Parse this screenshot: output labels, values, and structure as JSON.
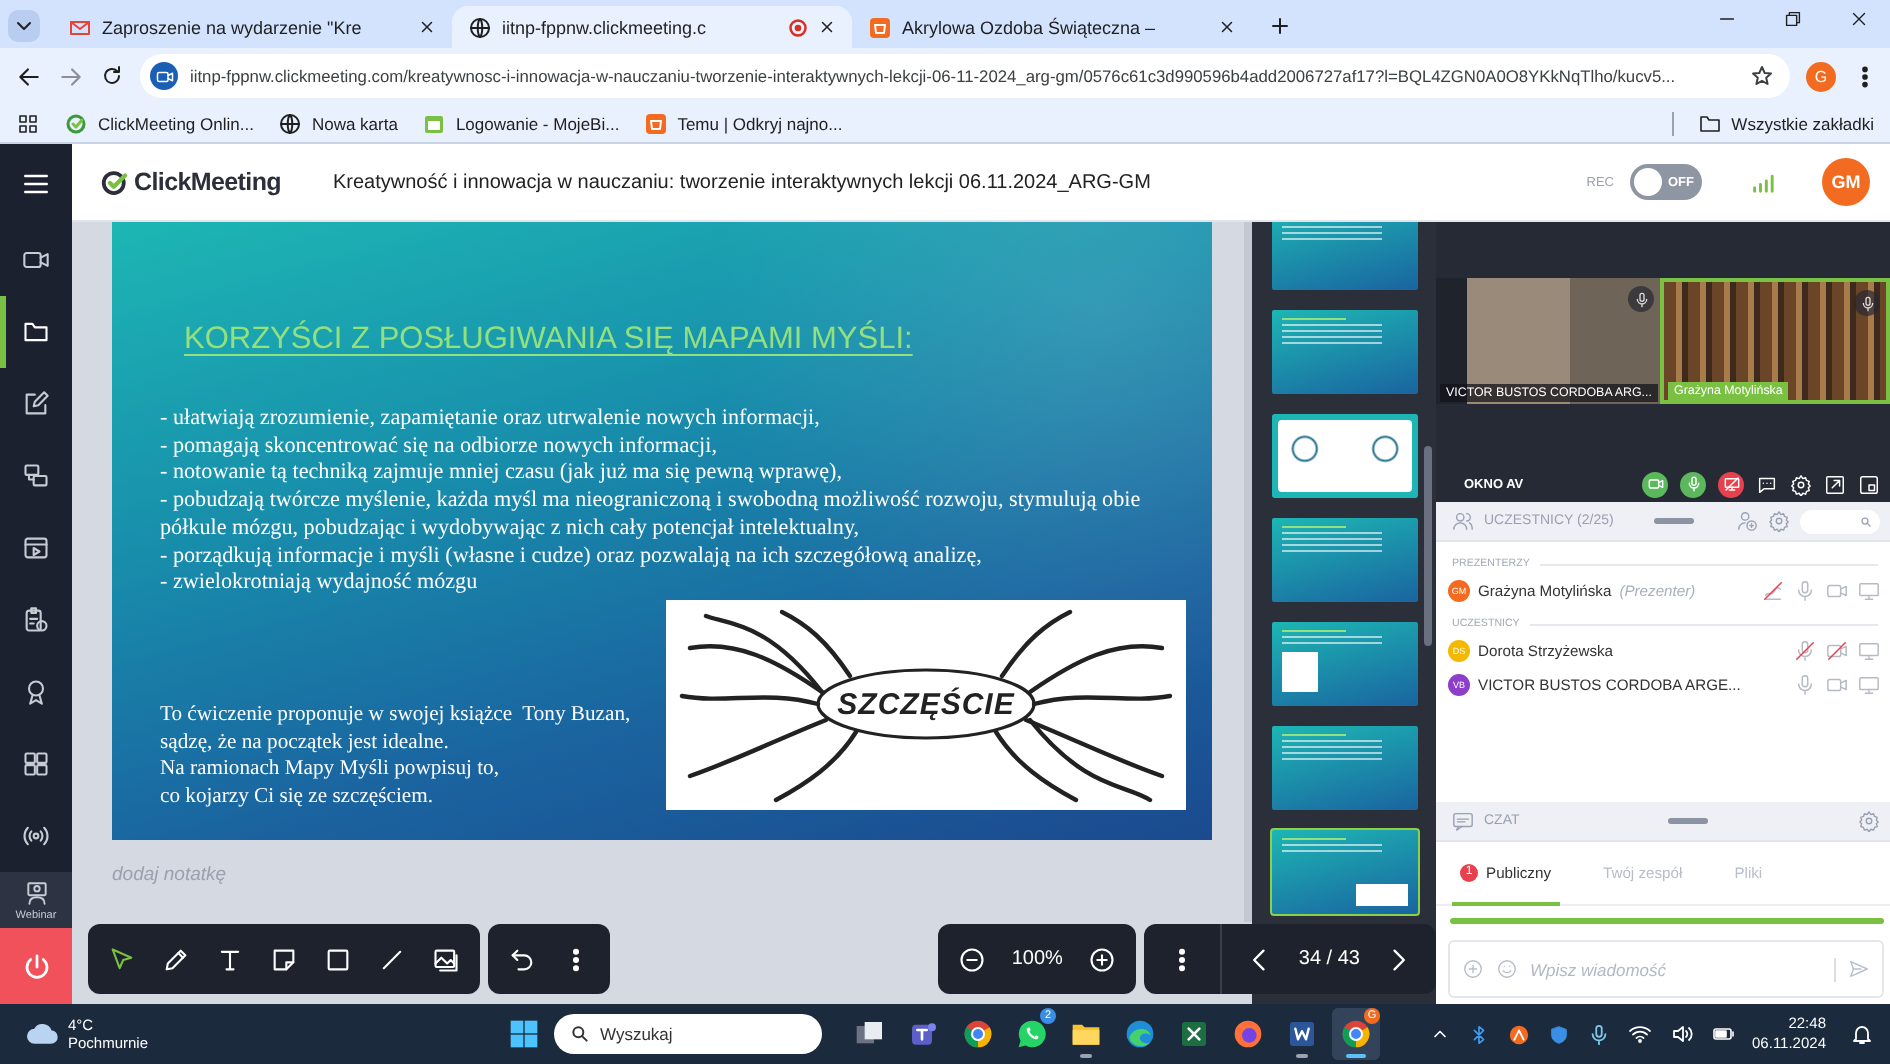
{
  "browser": {
    "tabs": [
      {
        "title": "Zaproszenie na wydarzenie \"Kre",
        "kind": "mail",
        "selected": false,
        "recording": false
      },
      {
        "title": "iitnp-fppnw.clickmeeting.c",
        "kind": "globe",
        "selected": true,
        "recording": true
      },
      {
        "title": "Akrylowa Ozdoba Świąteczna –",
        "kind": "shop",
        "selected": false,
        "recording": false
      }
    ],
    "url": "iitnp-fppnw.clickmeeting.com/kreatywnosc-i-innowacja-w-nauczaniu-tworzenie-interaktywnych-lekcji-06-11-2024_arg-gm/0576c61c3d990596b4add2006727af17?l=BQL4ZGN0A0O8YKkNqTlho/kucv5...",
    "profile": "G",
    "bookmarks": [
      {
        "label": "ClickMeeting Onlin...",
        "kind": "logo"
      },
      {
        "label": "Nowa karta",
        "kind": "globe"
      },
      {
        "label": "Logowanie - MojeBi...",
        "kind": "calendar"
      },
      {
        "label": "Temu | Odkryj najno...",
        "kind": "shop"
      }
    ],
    "all_bookmarks": "Wszystkie zakładki"
  },
  "header": {
    "logo": "ClickMeeting",
    "title": "Kreatywność i innowacja w nauczaniu: tworzenie interaktywnych lekcji 06.11.2024_ARG-GM",
    "rec_label": "REC",
    "rec_switch": {
      "label": "OFF",
      "on": false
    },
    "avatar": "GM"
  },
  "sidebar": {
    "items": [
      {
        "kind": "camera",
        "selected": false
      },
      {
        "kind": "folder",
        "selected": true
      },
      {
        "kind": "edit",
        "selected": false
      },
      {
        "kind": "screens",
        "selected": false
      },
      {
        "kind": "media",
        "selected": false
      },
      {
        "kind": "clipboard",
        "selected": false
      },
      {
        "kind": "badge",
        "selected": false
      },
      {
        "kind": "apps",
        "selected": false
      },
      {
        "kind": "broadcast",
        "selected": false
      },
      {
        "kind": "webinar",
        "label": "Webinar",
        "selected": false
      }
    ]
  },
  "slide": {
    "heading": "KORZYŚCI Z POSŁUGIWANIA SIĘ MAPAMI MYŚLI:",
    "bullets": [
      "- ułatwiają zrozumienie, zapamiętanie oraz utrwalenie nowych informacji,",
      "- pomagają skoncentrować się na odbiorze nowych informacji,",
      "- notowanie tą techniką zajmuje mniej czasu (jak już ma się pewną wprawę),",
      "- pobudzają twórcze myślenie, każda myśl ma nieograniczoną i swobodną możliwość rozwoju, stymulują obie półkule mózgu, pobudzając i wydobywając z nich cały potencjał intelektualny,",
      "- porządkują informacje i myśli (własne i cudze) oraz pozwalają na ich szczegółową analizę,",
      "- zwielokrotniają wydajność mózgu"
    ],
    "note_lines": [
      "To ćwiczenie proponuje w swojej książce  Tony Buzan,",
      "sądzę, że na początek jest idealne.",
      "Na ramionach Mapy Myśli powpisuj to,",
      "co kojarzy Ci się ze szczęściem."
    ],
    "map_word": "SZCZĘŚCIE"
  },
  "note_placeholder": "dodaj notatkę",
  "tools": [
    {
      "kind": "pointer",
      "selected": true
    },
    {
      "kind": "pencil",
      "selected": false
    },
    {
      "kind": "text",
      "selected": false
    },
    {
      "kind": "note",
      "selected": false
    },
    {
      "kind": "rectangle",
      "selected": false
    },
    {
      "kind": "line",
      "selected": false
    },
    {
      "kind": "image",
      "selected": false
    }
  ],
  "zoom": "100%",
  "page": "34 / 43",
  "thumbnails": [
    {
      "kind": "text",
      "selected": false
    },
    {
      "kind": "text",
      "selected": false
    },
    {
      "kind": "diagram",
      "selected": false
    },
    {
      "kind": "text",
      "selected": false
    },
    {
      "kind": "figure",
      "selected": false
    },
    {
      "kind": "text",
      "selected": false
    },
    {
      "kind": "map",
      "selected": true
    }
  ],
  "video": {
    "tiles": [
      {
        "name": "VICTOR BUSTOS CORDOBA ARG...",
        "speaking": false
      },
      {
        "name": "Grażyna Motylińska",
        "speaking": true
      }
    ]
  },
  "av": {
    "title": "OKNO AV",
    "controls": [
      {
        "kind": "camera",
        "on": true
      },
      {
        "kind": "mic",
        "on": true
      },
      {
        "kind": "screen",
        "on": false
      }
    ]
  },
  "participants": {
    "title": "UCZESTNICY (2/25)",
    "groups": [
      {
        "label": "PREZENTERZY",
        "people": [
          {
            "initials": "GM",
            "name": "Grażyna Motylińska",
            "role": "(Prezenter)",
            "color": "#f26b21",
            "devices": [
              {
                "kind": "draw",
                "off": true
              },
              {
                "kind": "mic",
                "off": false
              },
              {
                "kind": "camera",
                "off": false
              },
              {
                "kind": "screen",
                "off": false
              }
            ]
          }
        ]
      },
      {
        "label": "UCZESTNICY",
        "people": [
          {
            "initials": "DS",
            "name": "Dorota Strzyżewska",
            "color": "#f5b800",
            "devices": [
              {
                "kind": "mic",
                "off": true
              },
              {
                "kind": "camera",
                "off": true
              },
              {
                "kind": "screen",
                "off": false
              }
            ]
          },
          {
            "initials": "VB",
            "name": "VICTOR BUSTOS CORDOBA ARGE...",
            "color": "#8e3fc9",
            "devices": [
              {
                "kind": "mic",
                "off": false
              },
              {
                "kind": "camera",
                "off": false
              },
              {
                "kind": "screen",
                "off": false
              }
            ]
          }
        ]
      }
    ]
  },
  "chat": {
    "title": "CZAT",
    "tabs": [
      {
        "label": "Publiczny",
        "badge": "1",
        "selected": true
      },
      {
        "label": "Twój zespół",
        "selected": false
      },
      {
        "label": "Pliki",
        "selected": false
      }
    ],
    "placeholder": "Wpisz wiadomość"
  },
  "taskbar": {
    "temperature": "4°C",
    "weather": "Pochmurnie",
    "search_placeholder": "Wyszukaj",
    "apps": [
      {
        "kind": "taskview",
        "running": false,
        "selected": false
      },
      {
        "kind": "teams",
        "running": false,
        "selected": false
      },
      {
        "kind": "chrome",
        "running": false,
        "selected": false
      },
      {
        "kind": "whatsapp",
        "badge": "2",
        "running": false,
        "selected": false
      },
      {
        "kind": "explorer",
        "running": true,
        "selected": false
      },
      {
        "kind": "edge",
        "running": false,
        "selected": false
      },
      {
        "kind": "excel",
        "running": false,
        "selected": false
      },
      {
        "kind": "firefox",
        "running": false,
        "selected": false
      },
      {
        "kind": "word",
        "running": true,
        "selected": false
      },
      {
        "kind": "chrome",
        "badge": "G",
        "running": true,
        "selected": true
      }
    ],
    "time": "22:48",
    "date": "06.11.2024"
  }
}
